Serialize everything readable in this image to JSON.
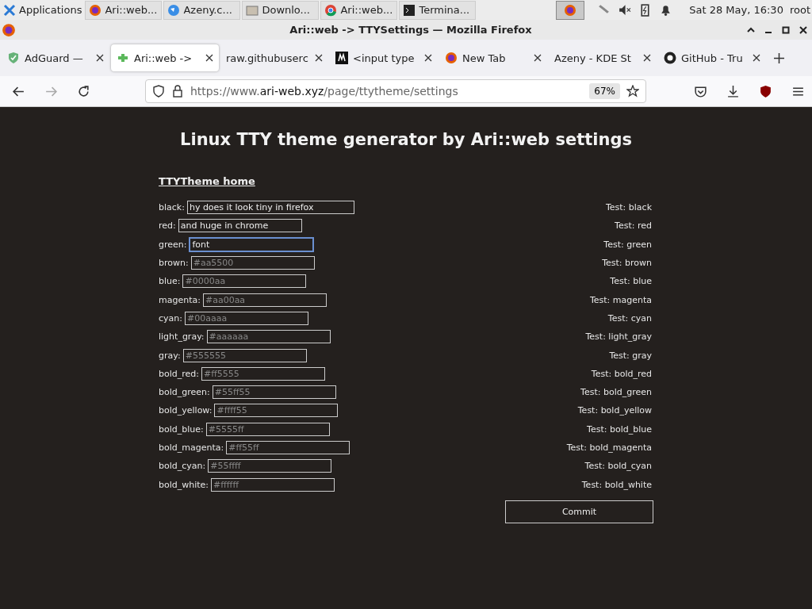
{
  "taskbar": {
    "menu": "Applications",
    "tasks": [
      {
        "label": "Ari::web...",
        "selected": false
      },
      {
        "label": "Azeny.c...",
        "selected": false
      },
      {
        "label": "Downlo...",
        "selected": false
      },
      {
        "label": "Ari::web...",
        "selected": false
      },
      {
        "label": "Termina...",
        "selected": false
      }
    ],
    "clock": "Sat 28 May, 16:30",
    "user": "root"
  },
  "window": {
    "title": "Ari::web -> TTYSettings — Mozilla Firefox"
  },
  "tabs": [
    {
      "label": "AdGuard —",
      "selected": false
    },
    {
      "label": "Ari::web ->",
      "selected": true
    },
    {
      "label": "raw.githubuserc",
      "selected": false
    },
    {
      "label": "<input type",
      "selected": false
    },
    {
      "label": "New Tab",
      "selected": false
    },
    {
      "label": "Azeny - KDE St",
      "selected": false
    },
    {
      "label": "GitHub - Tru",
      "selected": false
    }
  ],
  "address_bar": {
    "prefix": "https://www.",
    "domain": "ari-web.xyz",
    "path": "/page/ttytheme/settings",
    "zoom": "67%"
  },
  "page": {
    "heading": "Linux TTY theme generator by Ari::web settings",
    "home_link": "TTYTheme home",
    "fields": [
      {
        "label": "black:",
        "value": "hy does it look tiny in firefox",
        "focused": false,
        "test": "Test: black"
      },
      {
        "label": "red:",
        "value": "and huge in chrome",
        "focused": false,
        "test": "Test: red"
      },
      {
        "label": "green:",
        "value": "font ",
        "focused": true,
        "test": "Test: green"
      },
      {
        "label": "brown:",
        "placeholder": "#aa5500",
        "focused": false,
        "test": "Test: brown"
      },
      {
        "label": "blue:",
        "placeholder": "#0000aa",
        "focused": false,
        "test": "Test: blue"
      },
      {
        "label": "magenta:",
        "placeholder": "#aa00aa",
        "focused": false,
        "test": "Test: magenta"
      },
      {
        "label": "cyan:",
        "placeholder": "#00aaaa",
        "focused": false,
        "test": "Test: cyan"
      },
      {
        "label": "light_gray:",
        "placeholder": "#aaaaaa",
        "focused": false,
        "test": "Test: light_gray"
      },
      {
        "label": "gray:",
        "placeholder": "#555555",
        "focused": false,
        "test": "Test: gray"
      },
      {
        "label": "bold_red:",
        "placeholder": "#ff5555",
        "focused": false,
        "test": "Test: bold_red"
      },
      {
        "label": "bold_green:",
        "placeholder": "#55ff55",
        "focused": false,
        "test": "Test: bold_green"
      },
      {
        "label": "bold_yellow:",
        "placeholder": "#ffff55",
        "focused": false,
        "test": "Test: bold_yellow"
      },
      {
        "label": "bold_blue:",
        "placeholder": "#5555ff",
        "focused": false,
        "test": "Test: bold_blue"
      },
      {
        "label": "bold_magenta:",
        "placeholder": "#ff55ff",
        "focused": false,
        "test": "Test: bold_magenta"
      },
      {
        "label": "bold_cyan:",
        "placeholder": "#55ffff",
        "focused": false,
        "test": "Test: bold_cyan"
      },
      {
        "label": "bold_white:",
        "placeholder": "#ffffff",
        "focused": false,
        "test": "Test: bold_white"
      }
    ],
    "commit": "Commit"
  }
}
